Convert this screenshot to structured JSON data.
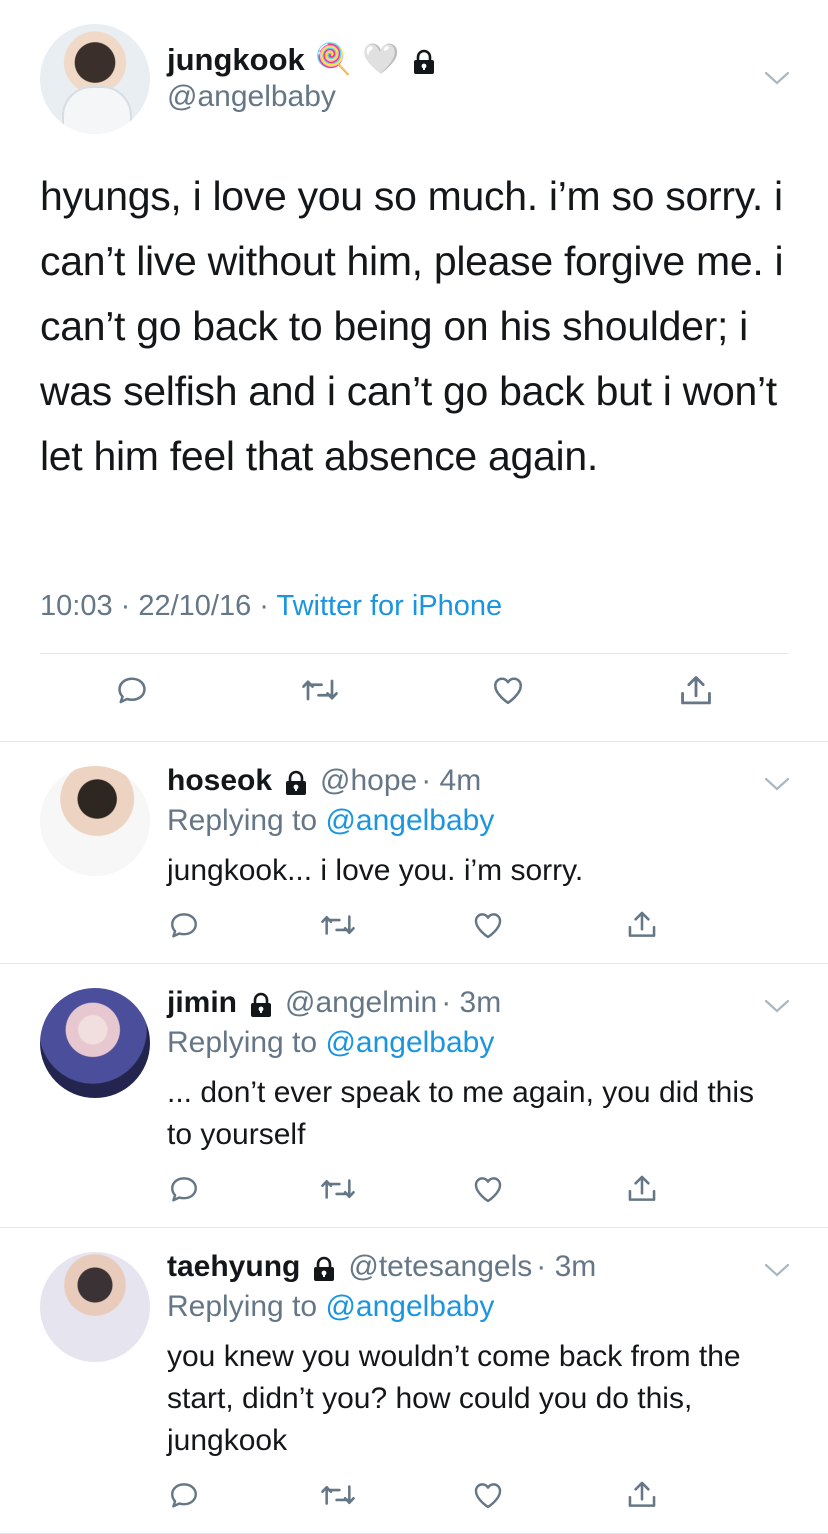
{
  "main_tweet": {
    "display_name": "jungkook",
    "badges": [
      "🍭",
      "🤍"
    ],
    "handle": "@angelbaby",
    "text": "hyungs, i love you so much. i’m so sorry. i can’t live without him, please forgive me. i can’t go back to being on his shoulder; i was selfish and i can’t go back but i won’t let him feel that absence again.",
    "time": "10:03",
    "date": "22/10/16",
    "separator": " · ",
    "source": "Twitter for iPhone"
  },
  "replies": [
    {
      "display_name": "hoseok",
      "handle": "@hope",
      "age": "· 4m",
      "replying_prefix": "Replying to ",
      "replying_to": "@angelbaby",
      "text": "jungkook... i love you. i’m sorry."
    },
    {
      "display_name": "jimin",
      "handle": "@angelmin",
      "age": "· 3m",
      "replying_prefix": "Replying to ",
      "replying_to": "@angelbaby",
      "text": "... don’t ever speak to me again, you did this to yourself"
    },
    {
      "display_name": "taehyung",
      "handle": "@tetesangels",
      "age": "· 3m",
      "replying_prefix": "Replying to ",
      "replying_to": "@angelbaby",
      "text": "you knew you wouldn’t come back from the start, didn’t you? how could you do this, jungkook"
    }
  ],
  "icons": {
    "reply": "reply-icon",
    "retweet": "retweet-icon",
    "like": "heart-icon",
    "share": "share-icon",
    "lock": "lock-icon",
    "chevron": "chevron-down-icon"
  },
  "colors": {
    "text": "#14171a",
    "secondary": "#657786",
    "link": "#1b95e0",
    "divider": "#e1e8ed"
  }
}
